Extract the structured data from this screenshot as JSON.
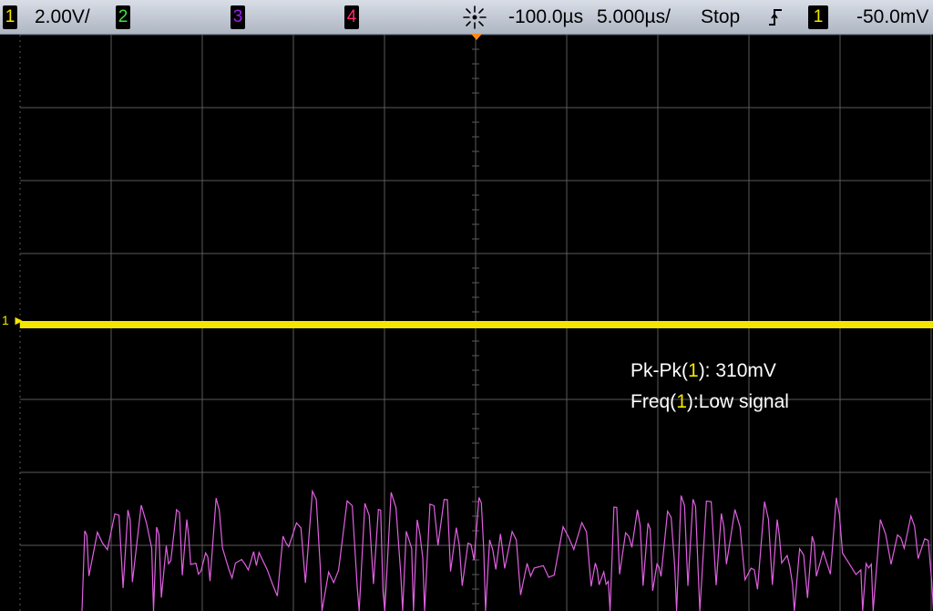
{
  "status_bar": {
    "ch1": {
      "label": "1",
      "scale": "2.00V/",
      "color": "#f4e500"
    },
    "ch2": {
      "label": "2",
      "color": "#3fe23f"
    },
    "ch3": {
      "label": "3",
      "color": "#a020f0"
    },
    "ch4": {
      "label": "4",
      "color": "#ff2a6d"
    },
    "run_icon": "acquire-icon",
    "delay": "-100.0µs",
    "timebase": "5.000µs/",
    "run_state": "Stop",
    "trigger_icon": "rising-edge-icon",
    "trigger_source": "1",
    "trigger_level": "-50.0mV"
  },
  "channel_marker": {
    "label": "1"
  },
  "measurements": {
    "pkpk_prefix": "Pk-Pk(",
    "pkpk_ch": "1",
    "pkpk_suffix": "): 310mV",
    "freq_prefix": "Freq(",
    "freq_ch": "1",
    "freq_suffix": "):Low signal"
  },
  "colors": {
    "grid": "#5a5a5a",
    "ch1": "#f4e500",
    "ch3_trace": "#e060e0",
    "trigger_marker": "#ff8c1a"
  }
}
